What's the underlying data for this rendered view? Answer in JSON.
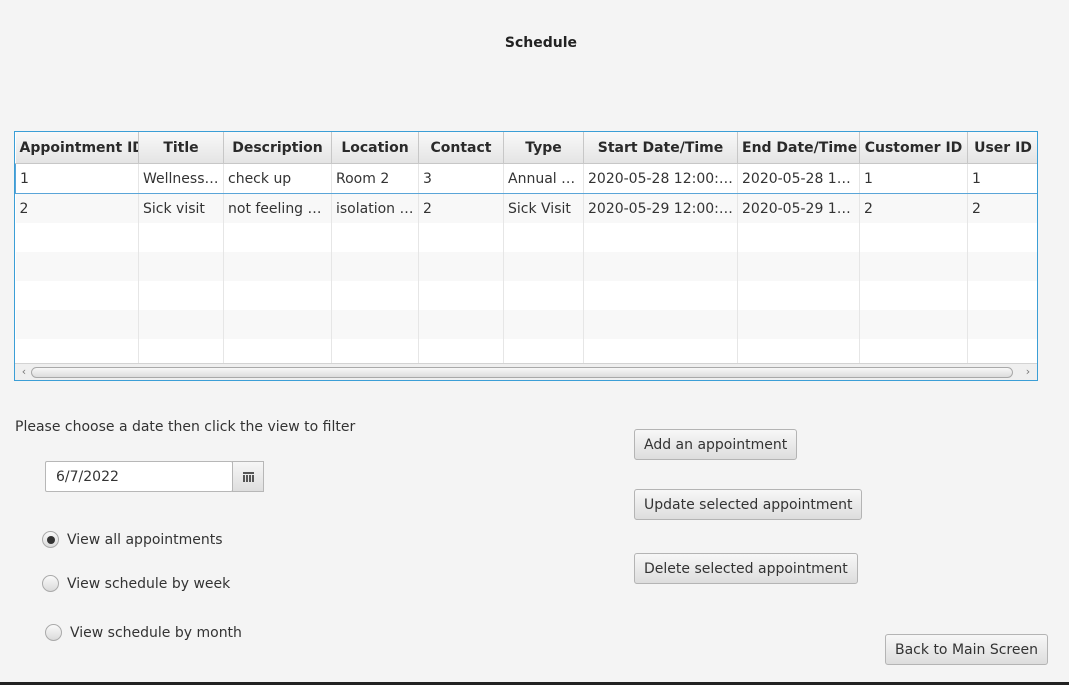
{
  "page": {
    "title": "Schedule"
  },
  "table": {
    "columns": [
      "Appointment ID",
      "Title",
      "Description",
      "Location",
      "Contact",
      "Type",
      "Start Date/Time",
      "End Date/Time",
      "Customer ID",
      "User ID"
    ],
    "rows": [
      [
        "1",
        "Wellness ...",
        "check up",
        "Room 2",
        "3",
        "Annual P...",
        "2020-05-28 12:00:0...",
        "2020-05-28 13:...",
        "1",
        "1"
      ],
      [
        "2",
        "Sick visit",
        "not feeling w...",
        "isolation r...",
        "2",
        "Sick Visit",
        "2020-05-29 12:00:0...",
        "2020-05-29 13:...",
        "2",
        "2"
      ]
    ],
    "selected_row": 0
  },
  "filter": {
    "instruction": "Please choose a date then click the view to filter",
    "date_value": "6/7/2022"
  },
  "views": {
    "all": "View all appointments",
    "week": "View schedule by week",
    "month": "View schedule by month",
    "selected": "all"
  },
  "actions": {
    "add": "Add an appointment",
    "update": "Update selected appointment",
    "delete": "Delete selected appointment",
    "back": "Back to Main Screen"
  }
}
